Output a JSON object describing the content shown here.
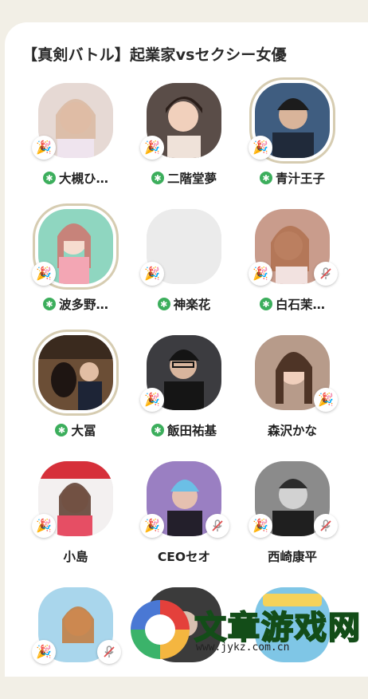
{
  "room": {
    "title": "【真剣バトル】起業家vsセクシー女優"
  },
  "icons": {
    "react": "party-popper-icon",
    "mute": "mic-off-icon",
    "moderator": "moderator-asterisk-icon"
  },
  "colors": {
    "moderator_badge": "#3cae5c",
    "ring": "#d6ccb1",
    "background": "#f2efe6"
  },
  "speakers": [
    {
      "name": "大槻ひ…",
      "moderator": true,
      "muted": false,
      "ring": false
    },
    {
      "name": "二階堂夢",
      "moderator": true,
      "muted": false,
      "ring": false
    },
    {
      "name": "青汁王子",
      "moderator": true,
      "muted": false,
      "ring": true
    },
    {
      "name": "波多野…",
      "moderator": true,
      "muted": false,
      "ring": true
    },
    {
      "name": "神楽花",
      "moderator": true,
      "muted": false,
      "ring": false
    },
    {
      "name": "白石茉…",
      "moderator": true,
      "muted": true,
      "ring": false
    },
    {
      "name": "大冨",
      "moderator": true,
      "muted": false,
      "ring": true
    },
    {
      "name": "飯田祐基",
      "moderator": true,
      "muted": false,
      "ring": false
    },
    {
      "name": "森沢かな",
      "moderator": false,
      "muted": false,
      "ring": false
    },
    {
      "name": "小島",
      "moderator": false,
      "muted": false,
      "ring": false
    },
    {
      "name": "CEOセオ",
      "moderator": false,
      "muted": true,
      "ring": false
    },
    {
      "name": "西崎康平",
      "moderator": false,
      "muted": true,
      "ring": false
    },
    {
      "name": "",
      "moderator": false,
      "muted": true,
      "ring": false
    },
    {
      "name": "",
      "moderator": false,
      "muted": false,
      "ring": false
    },
    {
      "name": "",
      "moderator": false,
      "muted": false,
      "ring": false
    }
  ],
  "watermark": {
    "text": "文章游戏网",
    "url": "www.jykz.com.cn"
  }
}
